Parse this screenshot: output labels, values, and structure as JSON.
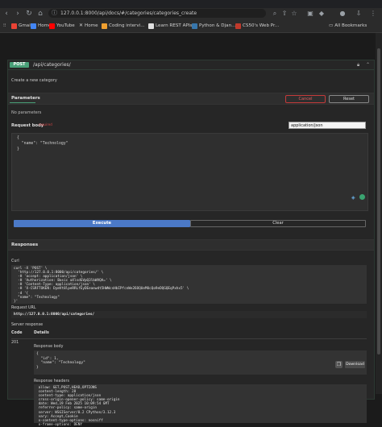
{
  "browser": {
    "url": "127.0.0.1:8000/api/docs/#/categories/categories_create",
    "bookmarks": [
      {
        "label": "Gmail",
        "color": "#ea4335"
      },
      {
        "label": "Home",
        "color": "#4285f4"
      },
      {
        "label": "YouTube",
        "color": "#ff0000"
      },
      {
        "label": "Home",
        "color": "#ffffff"
      },
      {
        "label": "Coding intervi...",
        "color": "#f0a030"
      },
      {
        "label": "Learn REST APIs",
        "color": "#e0e0e0"
      },
      {
        "label": "Python & Djan...",
        "color": "#3776ab"
      },
      {
        "label": "CS50's Web Pr...",
        "color": "#c0392b"
      }
    ],
    "all_bookmarks": "All Bookmarks"
  },
  "operation": {
    "method": "POST",
    "path": "/api/categories/",
    "description": "Create a new category"
  },
  "parameters": {
    "title": "Parameters",
    "cancel": "Cancel",
    "reset": "Reset",
    "empty": "No parameters"
  },
  "request_body": {
    "title": "Request body",
    "required": "required",
    "content_type": "application/json",
    "text": "{\n  \"name\": \"Technology\"\n}"
  },
  "actions": {
    "execute": "Execute",
    "clear": "Clear"
  },
  "responses": {
    "title": "Responses",
    "curl_label": "Curl",
    "curl_text": "curl -X 'POST' \\\n  'http://127.0.0.1:8000/api/categories/' \\\n  -H 'accept: application/json' \\\n  -H 'Authorization: Basic aXlsdGVpQ3lbWVQA=' \\\n  -H 'Content-Type: application/json' \\\n  -H 'X-CSRFTOKEN: DymVt8lpeRRLfEyDEeaewdt5HWWcsHbIPfcnWe26OQUeMUcQo9eDQGQEqPxhx5' \\\n  -d '{\n  \"name\": \"Technology\"\n}'",
    "request_url_label": "Request URL",
    "request_url": "http://127.0.0.1:8000/api/categories/",
    "server_response": "Server response",
    "col_code": "Code",
    "col_details": "Details",
    "code": "201",
    "response_body_label": "Response body",
    "response_body": "{\n  \"id\": 1,\n  \"name\": \"Technology\"\n}",
    "download": "Download",
    "response_headers_label": "Response headers",
    "response_headers": " allow: GET,POST,HEAD,OPTIONS\n content-length: 28\n content-type: application/json\n cross-origin-opener-policy: same-origin\n date: Wed,19 Feb 2025 10:09:54 GMT\n referrer-policy: same-origin\n server: WSGIServer/0.2 CPython/3.12.3\n vary: Accept,Cookie\n x-content-type-options: nosniff\n x-frame-options: DENY"
  }
}
